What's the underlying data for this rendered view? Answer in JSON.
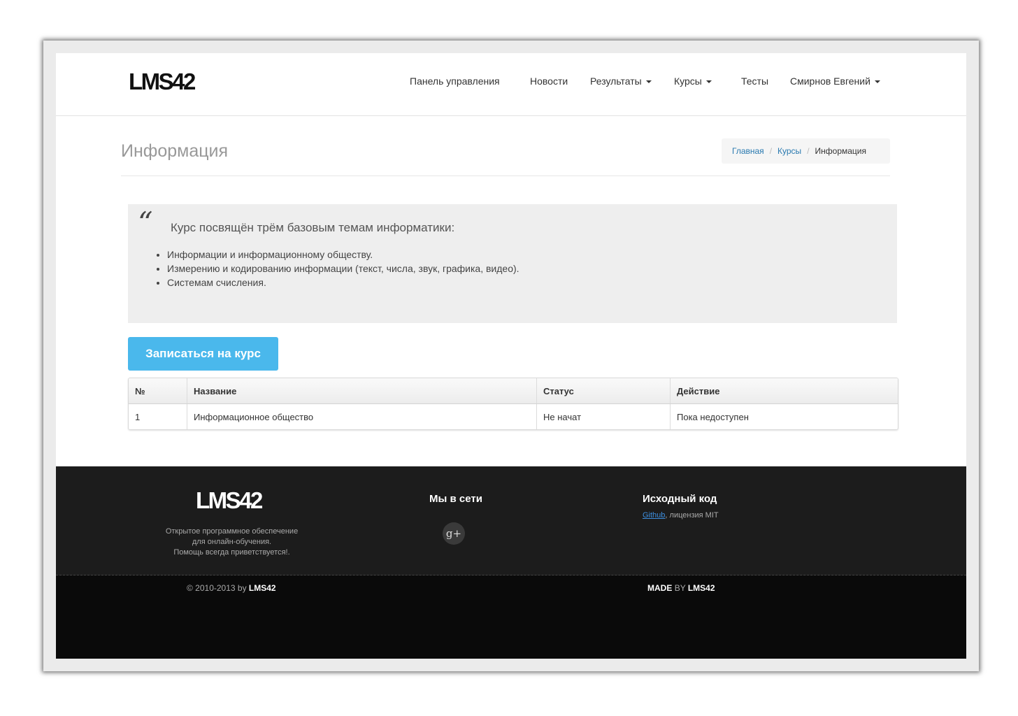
{
  "header": {
    "logo": "LMS42",
    "nav": {
      "dashboard": "Панель управления",
      "news": "Новости",
      "results": "Результаты",
      "courses": "Курсы",
      "tests": "Тесты",
      "user": "Смирнов Евгений"
    }
  },
  "page": {
    "title": "Информация",
    "breadcrumb": {
      "home": "Главная",
      "courses": "Курсы",
      "current": "Информация"
    }
  },
  "quote": {
    "mark": "“",
    "lead": "Курс посвящён трём базовым темам информатики:",
    "items": [
      "Информации и информационному обществу.",
      "Измерению и кодированию информации (текст, числа, звук, графика, видео).",
      "Системам счисления."
    ]
  },
  "enroll_button": "Записаться на курс",
  "table": {
    "headers": [
      "№",
      "Название",
      "Статус",
      "Действие"
    ],
    "rows": [
      [
        "1",
        "Информационное общество",
        "Не начат",
        "Пока недоступен"
      ]
    ]
  },
  "footer": {
    "logo": "LMS42",
    "desc_lines": [
      "Открытое программное обеспечение",
      "для онлайн-обучения.",
      "Помощь всегда приветствуется!."
    ],
    "social_heading": "Мы в сети",
    "gplus": "g+",
    "source_heading": "Исходный код",
    "github_link": "Github",
    "license_text": ", лицензия MIT",
    "copyright_prefix": "© 2010-2013 by",
    "copyright_brand": "LMS42",
    "made_label": "MADE",
    "made_by": "BY",
    "made_brand": "LMS42"
  }
}
